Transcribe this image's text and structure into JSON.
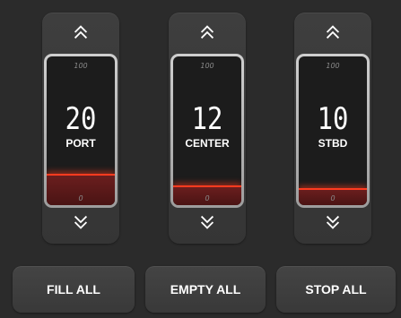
{
  "tanks": [
    {
      "label": "PORT",
      "value": "20",
      "scale_max": "100",
      "scale_min": "0",
      "level_percent": 20
    },
    {
      "label": "CENTER",
      "value": "12",
      "scale_max": "100",
      "scale_min": "0",
      "level_percent": 12
    },
    {
      "label": "STBD",
      "value": "10",
      "scale_max": "100",
      "scale_min": "0",
      "level_percent": 10
    }
  ],
  "buttons": {
    "fill_all": "FILL ALL",
    "empty_all": "EMPTY ALL",
    "stop_all": "STOP ALL"
  },
  "icons": {
    "increase": "double-chevron-up-icon",
    "decrease": "double-chevron-down-icon"
  },
  "colors": {
    "background": "#2b2b2b",
    "fill_line": "#ff3b1f",
    "fill": "#5a1818"
  }
}
